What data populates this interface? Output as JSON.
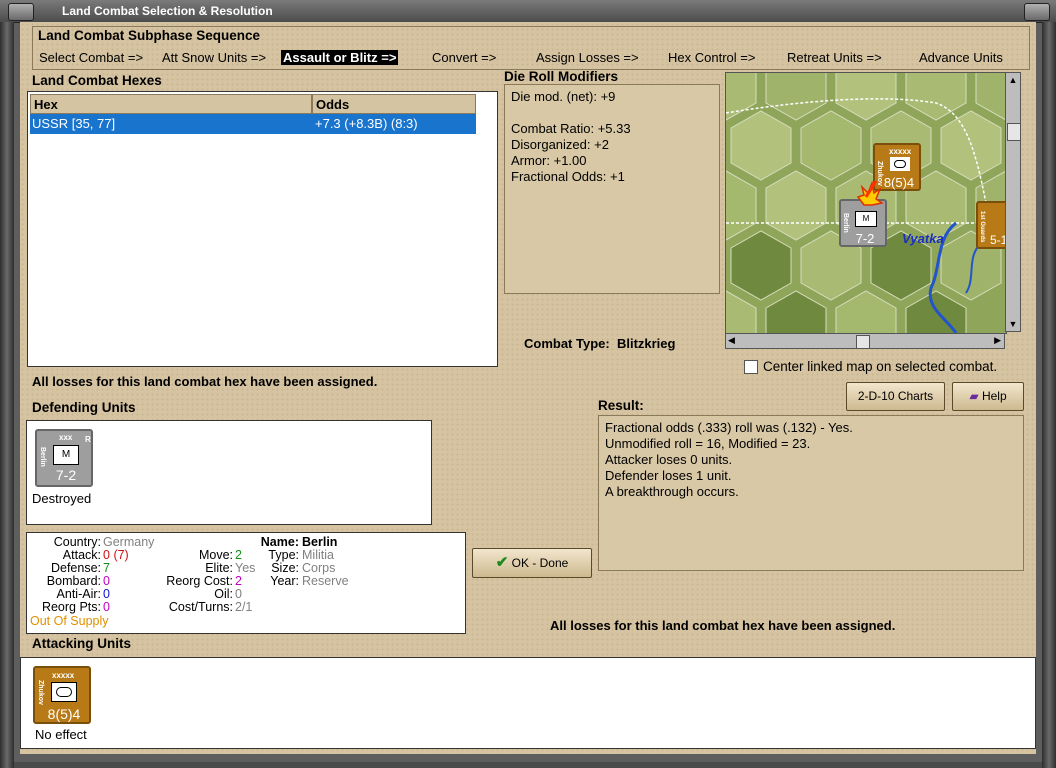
{
  "window": {
    "title": "Land Combat Selection & Resolution"
  },
  "sequence": {
    "title": "Land Combat Subphase Sequence",
    "steps": [
      "Select Combat =>",
      "Att Snow Units =>",
      "Assault or Blitz =>",
      "Convert =>",
      "Assign Losses =>",
      "Hex Control =>",
      "Retreat Units =>",
      "Advance Units"
    ],
    "active_index": 2
  },
  "hexes": {
    "title": "Land Combat Hexes",
    "columns": [
      "Hex",
      "Odds"
    ],
    "rows": [
      {
        "hex": "USSR [35, 77]",
        "odds": "+7.3 (+8.3B) (8:3)"
      }
    ]
  },
  "die_roll": {
    "title": "Die Roll Modifiers",
    "lines": [
      "Die mod. (net): +9",
      "",
      "Combat Ratio: +5.33",
      "Disorganized: +2",
      "Armor: +1.00",
      "Fractional Odds: +1"
    ]
  },
  "combat_type": {
    "label": "Combat Type:",
    "value": "Blitzkrieg"
  },
  "map": {
    "river_label": "Vyatka",
    "center_checkbox_label": "Center linked map on selected combat.",
    "center_checked": false
  },
  "buttons": {
    "charts": "2-D-10 Charts",
    "help": "Help",
    "ok": "OK - Done"
  },
  "losses_status": "All losses for this land combat hex have been assigned.",
  "result": {
    "title": "Result:",
    "lines": [
      "Fractional odds (.333) roll was (.132)  - Yes.",
      "Unmodified roll = 16, Modified = 23.",
      "Attacker loses 0 units.",
      "Defender loses 1 unit.",
      "A breakthrough occurs."
    ]
  },
  "defending": {
    "title": "Defending Units",
    "unit": {
      "size": "xxx",
      "flag": "R",
      "name": "Berlin",
      "type_symbol": "M",
      "strength": "7-2",
      "status": "Destroyed"
    }
  },
  "attacking": {
    "title": "Attacking Units",
    "unit": {
      "size": "xxxxx",
      "name": "Zhukov",
      "strength": "8(5)4",
      "status": "No effect"
    }
  },
  "map_units": {
    "zhukov": {
      "size": "xxxxx",
      "name": "Zhukov",
      "strength": "8(5)4"
    },
    "berlin": {
      "name": "Berlin",
      "type_symbol": "M",
      "strength": "7-2"
    },
    "edge": {
      "name": "1st Guards",
      "strength": "5-1"
    }
  },
  "stats": {
    "country_label": "Country:",
    "country": "Germany",
    "attack_label": "Attack:",
    "attack": "0",
    "attack_extra": "(7)",
    "defense_label": "Defense:",
    "defense": "7",
    "bombard_label": "Bombard:",
    "bombard": "0",
    "antiair_label": "Anti-Air:",
    "antiair": "0",
    "reorgpts_label": "Reorg Pts:",
    "reorgpts": "0",
    "supply": "Out Of Supply",
    "move_label": "Move:",
    "move": "2",
    "elite_label": "Elite:",
    "elite": "Yes",
    "reorgcost_label": "Reorg Cost:",
    "reorgcost": "2",
    "oil_label": "Oil:",
    "oil": "0",
    "costturns_label": "Cost/Turns:",
    "costturns": "2/1",
    "name_label": "Name:",
    "name": "Berlin",
    "type_label": "Type:",
    "type": "Militia",
    "size_label": "Size:",
    "size": "Corps",
    "year_label": "Year:",
    "year": "Reserve"
  },
  "colors": {
    "highlight": "#1874cd",
    "soviet_unit": "#b87a16",
    "german_unit": "#9e9e9e",
    "attack_red": "#d01010",
    "defense_green": "#129012",
    "bombard_magenta": "#c000c0",
    "antiair_blue": "#1010d0",
    "supply_orange": "#e09000"
  }
}
